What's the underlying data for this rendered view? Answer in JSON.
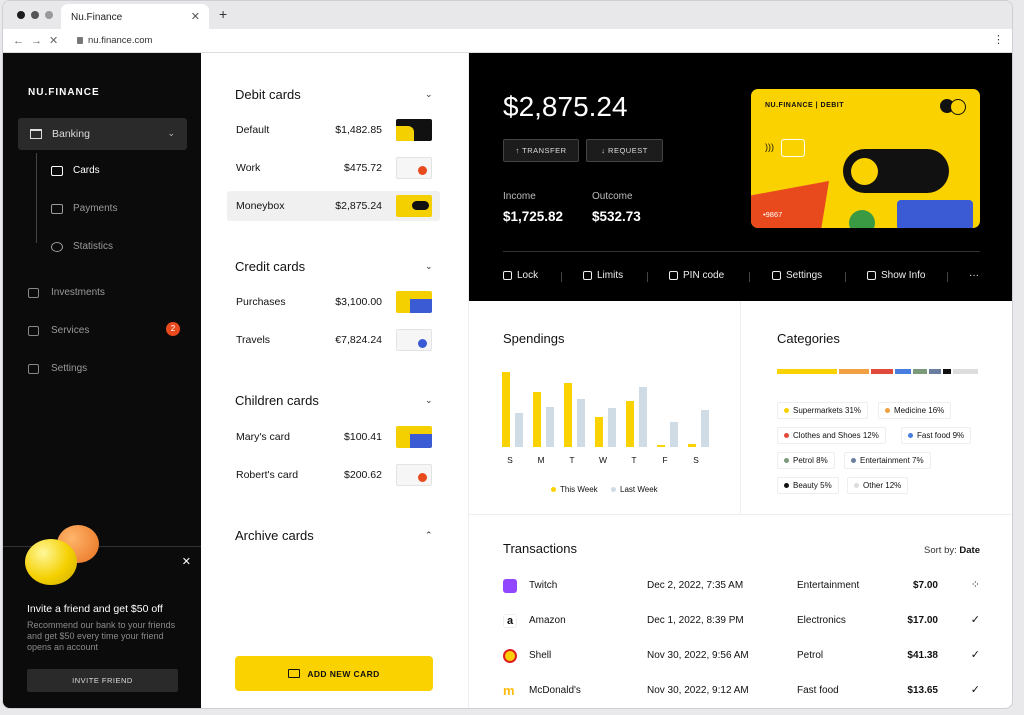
{
  "browser": {
    "tab_title": "Nu.Finance",
    "url": "nu.finance.com"
  },
  "sidebar": {
    "logo": "NU.FINANCE",
    "banking": "Banking",
    "sub_items": [
      "Cards",
      "Payments",
      "Statistics"
    ],
    "items": [
      {
        "label": "Investments"
      },
      {
        "label": "Services",
        "badge": "2"
      },
      {
        "label": "Settings"
      }
    ],
    "promo": {
      "title": "Invite a friend and get $50 off",
      "text": "Recommend our bank to your friends and get $50 every time your friend opens an account",
      "button": "INVITE FRIEND"
    }
  },
  "cards_panel": {
    "debit_title": "Debit cards",
    "debit": [
      {
        "name": "Default",
        "amount": "$1,482.85"
      },
      {
        "name": "Work",
        "amount": "$475.72"
      },
      {
        "name": "Moneybox",
        "amount": "$2,875.24"
      }
    ],
    "credit_title": "Credit cards",
    "credit": [
      {
        "name": "Purchases",
        "amount": "$3,100.00"
      },
      {
        "name": "Travels",
        "amount": "€7,824.24"
      }
    ],
    "children_title": "Children cards",
    "children": [
      {
        "name": "Mary's card",
        "amount": "$100.41"
      },
      {
        "name": "Robert's card",
        "amount": "$200.62"
      }
    ],
    "archive_title": "Archive cards",
    "add_button": "ADD NEW CARD"
  },
  "hero": {
    "balance": "$2,875.24",
    "transfer": "↑ TRANSFER",
    "request": "↓ REQUEST",
    "income_label": "Income",
    "income": "$1,725.82",
    "outcome_label": "Outcome",
    "outcome": "$532.73",
    "card_brand": "NU.FINANCE | DEBIT",
    "card_number": "•9867",
    "actions": [
      "Lock",
      "Limits",
      "PIN code",
      "Settings",
      "Show Info",
      "···"
    ]
  },
  "spendings": {
    "title": "Spendings",
    "legend": [
      "This Week",
      "Last Week"
    ]
  },
  "chart_data": {
    "type": "bar",
    "title": "Spendings",
    "categories": [
      "S",
      "M",
      "T",
      "W",
      "T",
      "F",
      "S"
    ],
    "series": [
      {
        "name": "This Week",
        "values": [
          75,
          55,
          64,
          30,
          46,
          2,
          3
        ]
      },
      {
        "name": "Last Week",
        "values": [
          34,
          40,
          48,
          39,
          60,
          25,
          37
        ]
      }
    ],
    "colors": {
      "this_week": "#f9d200",
      "last_week": "#cfdbe5"
    },
    "grid": false,
    "legend_position": "bottom"
  },
  "categories": {
    "title": "Categories",
    "items": [
      {
        "label": "Supermarkets",
        "pct": "31%",
        "color": "#f9d200"
      },
      {
        "label": "Medicine",
        "pct": "16%",
        "color": "#f0a040"
      },
      {
        "label": "Clothes and Shoes",
        "pct": "12%",
        "color": "#e04a3a"
      },
      {
        "label": "Fast food",
        "pct": "9%",
        "color": "#4a7de0"
      },
      {
        "label": "Petrol",
        "pct": "8%",
        "color": "#7a9a7a"
      },
      {
        "label": "Entertainment",
        "pct": "7%",
        "color": "#6a7fa0"
      },
      {
        "label": "Beauty",
        "pct": "5%",
        "color": "#111111"
      },
      {
        "label": "Other",
        "pct": "12%",
        "color": "#dddddd"
      }
    ]
  },
  "transactions": {
    "title": "Transactions",
    "sort_label": "Sort by:",
    "sort_value": "Date",
    "rows": [
      {
        "merchant": "Twitch",
        "date": "Dec 2, 2022, 7:35 AM",
        "category": "Entertainment",
        "amount": "$7.00",
        "status": "⁘"
      },
      {
        "merchant": "Amazon",
        "date": "Dec 1, 2022, 8:39 PM",
        "category": "Electronics",
        "amount": "$17.00",
        "status": "✓"
      },
      {
        "merchant": "Shell",
        "date": "Nov 30, 2022, 9:56 AM",
        "category": "Petrol",
        "amount": "$41.38",
        "status": "✓"
      },
      {
        "merchant": "McDonald's",
        "date": "Nov 30, 2022, 9:12 AM",
        "category": "Fast food",
        "amount": "$13.65",
        "status": "✓"
      }
    ]
  }
}
